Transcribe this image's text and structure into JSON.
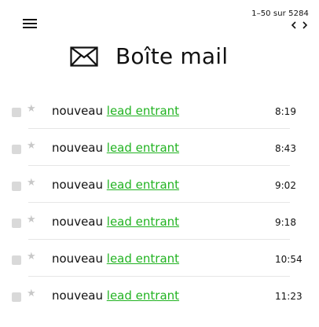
{
  "pager": {
    "text": "1–50 sur 5284"
  },
  "header": {
    "title": "Boîte mail"
  },
  "emails": [
    {
      "prefix": "nouveau",
      "link": "lead entrant",
      "time": "8:19"
    },
    {
      "prefix": "nouveau",
      "link": "lead entrant",
      "time": "8:43"
    },
    {
      "prefix": "nouveau",
      "link": "lead entrant",
      "time": "9:02"
    },
    {
      "prefix": "nouveau",
      "link": "lead entrant",
      "time": "9:18"
    },
    {
      "prefix": "nouveau",
      "link": "lead entrant",
      "time": "10:54"
    },
    {
      "prefix": "nouveau",
      "link": "lead entrant",
      "time": "11:23"
    }
  ],
  "colors": {
    "link": "#22b322",
    "checkbox": "#d9d9d9",
    "star": "#c8c8c8"
  },
  "icons": {
    "menu": "hamburger-icon",
    "mail": "envelope-icon",
    "prev": "chevron-left-icon",
    "next": "chevron-right-icon",
    "star": "star-icon"
  }
}
